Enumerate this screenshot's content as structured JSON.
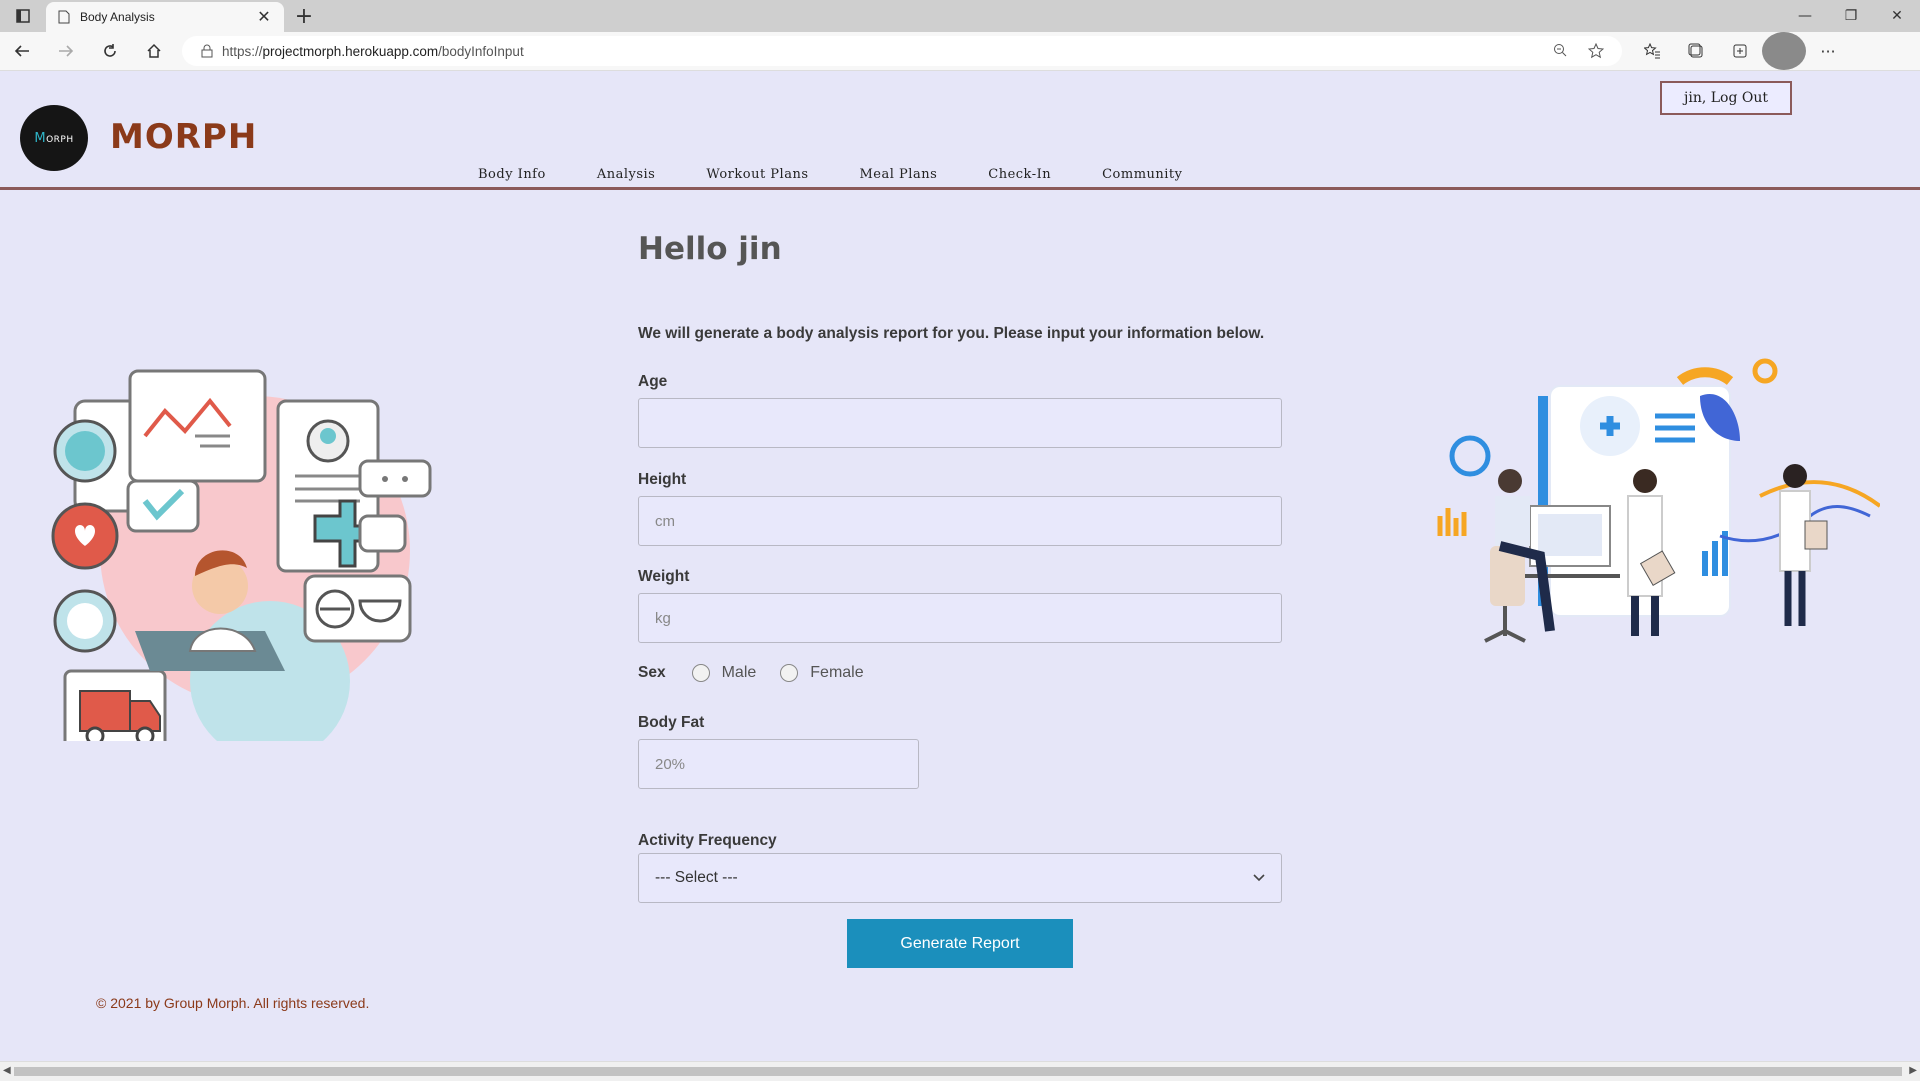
{
  "browser": {
    "tab_title": "Body Analysis",
    "url_prefix": "https://",
    "url_domain": "projectmorph.herokuapp.com",
    "url_path": "/bodyInfoInput"
  },
  "header": {
    "logo_text_first": "M",
    "logo_text_rest": "ORPH",
    "brand": "MORPH",
    "logout_label": "jin, Log Out",
    "nav": [
      "Body Info",
      "Analysis",
      "Workout Plans",
      "Meal Plans",
      "Check-In",
      "Community"
    ]
  },
  "main": {
    "greeting": "Hello jin",
    "intro": "We will generate a body analysis report for you. Please input your information below.",
    "age_label": "Age",
    "age_value": "",
    "height_label": "Height",
    "height_placeholder": "cm",
    "weight_label": "Weight",
    "weight_placeholder": "kg",
    "sex_label": "Sex",
    "sex_options": [
      "Male",
      "Female"
    ],
    "bodyfat_label": "Body Fat",
    "bodyfat_placeholder": "20%",
    "activity_label": "Activity Frequency",
    "activity_selected": "--- Select ---",
    "submit_label": "Generate Report"
  },
  "footer": {
    "copyright": "© 2021 by Group Morph. All rights reserved."
  },
  "colors": {
    "accent": "#1b8fbc",
    "brand": "#8b3a1a",
    "background": "#e6e6f8"
  }
}
